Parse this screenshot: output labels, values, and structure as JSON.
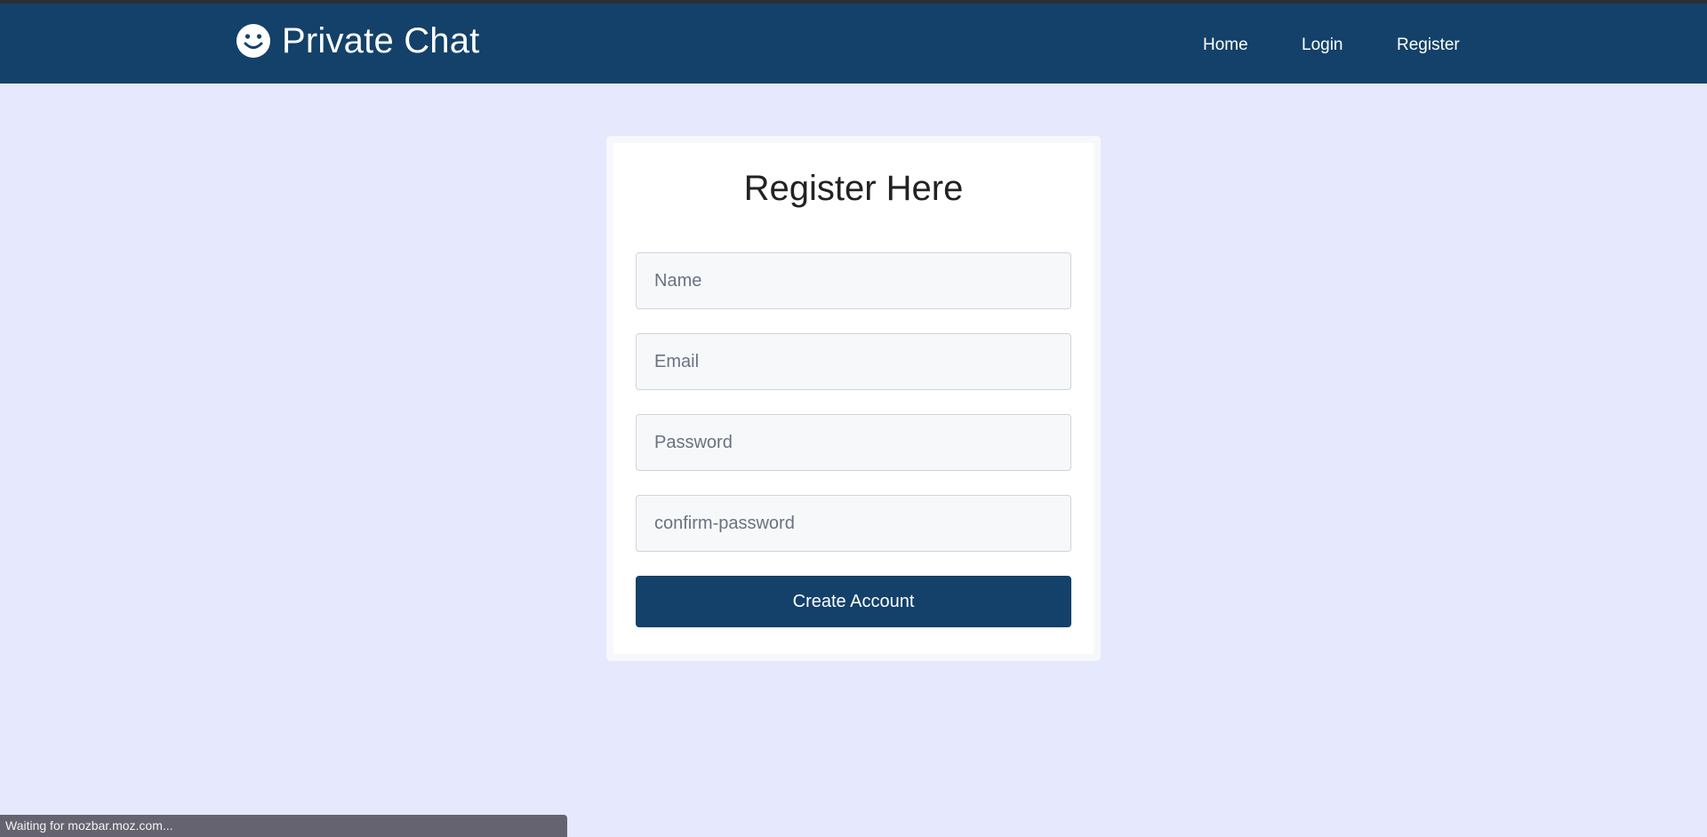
{
  "header": {
    "brand_title": "Private Chat",
    "brand_icon": "smiley-icon",
    "nav": {
      "home": "Home",
      "login": "Login",
      "register": "Register"
    }
  },
  "form": {
    "title": "Register Here",
    "fields": {
      "name": {
        "placeholder": "Name",
        "value": ""
      },
      "email": {
        "placeholder": "Email",
        "value": ""
      },
      "password": {
        "placeholder": "Password",
        "value": ""
      },
      "confirm_password": {
        "placeholder": "confirm-password",
        "value": ""
      }
    },
    "submit_label": "Create Account"
  },
  "status_bar": {
    "text": "Waiting for mozbar.moz.com..."
  },
  "colors": {
    "navbar": "#134169",
    "background": "#e6e8fd",
    "button": "#134169",
    "card": "#ffffff"
  }
}
